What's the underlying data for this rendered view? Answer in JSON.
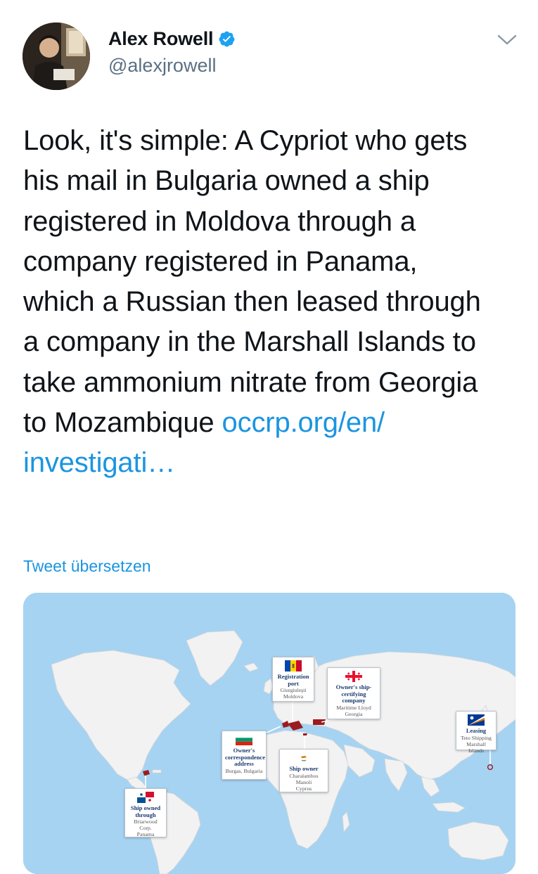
{
  "tweet": {
    "author": {
      "display_name": "Alex Rowell",
      "handle": "@alexjrowell",
      "verified": true
    },
    "text_lines": [
      "Look, it's simple: A Cypriot who gets",
      "his mail in Bulgaria owned a ship",
      "registered in Moldova through a",
      "company registered in Panama,",
      "which a Russian then leased through",
      "a company in the Marshall Islands to",
      "take ammonium nitrate from Georgia"
    ],
    "last_line_text": "to Mozambique ",
    "link_line1": "occrp.org/en/",
    "link_line2": "investigati…",
    "translate_label": "Tweet übersetzen",
    "icons": {
      "verified": "verified-badge-icon",
      "menu": "chevron-down-icon"
    },
    "colors": {
      "link": "#1b95e0",
      "handle": "#5b7083",
      "verified": "#1da1f2"
    }
  },
  "map": {
    "callouts": {
      "registration": {
        "title": "Registration port",
        "line1": "Giurgiuleşti",
        "line2": "Moldova"
      },
      "certifying": {
        "title1": "Owner's ship-",
        "title2": "certifying company",
        "line1": "Maritime Lloyd",
        "line2": "Georgia"
      },
      "leasing": {
        "title": "Leasing",
        "line1": "Teto Shipping",
        "line2": "Marshall Islands"
      },
      "correspondence": {
        "title1": "Owner's",
        "title2": "correspondence",
        "title3": "address",
        "line1": "Burgas, Bulgaria"
      },
      "ship_owner": {
        "title": "Ship owner",
        "line1": "Charalambos Manoli",
        "line2": "Cyprus"
      },
      "owned_through": {
        "title1": "Ship owned",
        "title2": "through",
        "line1": "Briarwood Corp.",
        "line2": "Panama"
      }
    },
    "colors": {
      "ocean": "#a6d3f2",
      "land": "#f2f2f2",
      "highlight": "#9b1b1f",
      "callout_title": "#1c3b70"
    }
  }
}
